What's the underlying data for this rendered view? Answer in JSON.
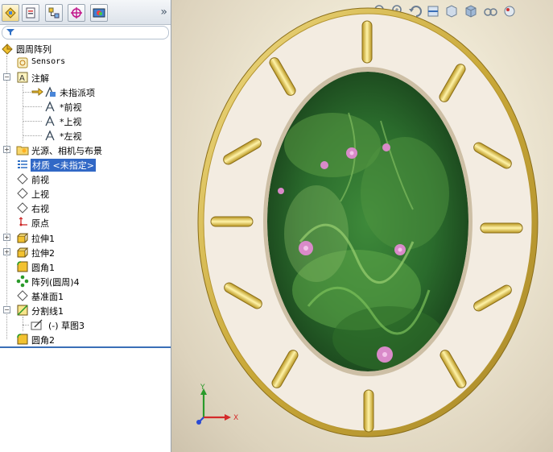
{
  "feature_tree": {
    "items": [
      {
        "label": "圆周阵列"
      },
      {
        "label": "Sensors"
      },
      {
        "label": "注解"
      },
      {
        "label": "未指派项"
      },
      {
        "label": "*前视"
      },
      {
        "label": "*上视"
      },
      {
        "label": "*左视"
      },
      {
        "label": "光源、相机与布景"
      },
      {
        "label": "材质 <未指定>"
      },
      {
        "label": "前视"
      },
      {
        "label": "上视"
      },
      {
        "label": "右视"
      },
      {
        "label": "原点"
      },
      {
        "label": "拉伸1"
      },
      {
        "label": "拉伸2"
      },
      {
        "label": "圆角1"
      },
      {
        "label": "阵列(圆周)4"
      },
      {
        "label": "基准面1"
      },
      {
        "label": "分割线1"
      },
      {
        "label": "(-) 草图3"
      },
      {
        "label": "圆角2"
      }
    ]
  },
  "toolbar": {
    "more": "»"
  },
  "triad": {
    "x": "X",
    "y": "Y"
  },
  "colors": {
    "selection": "#3168c6",
    "ring": "#f3ece1",
    "rim": "#c9a838",
    "slot": "#ead36a"
  }
}
